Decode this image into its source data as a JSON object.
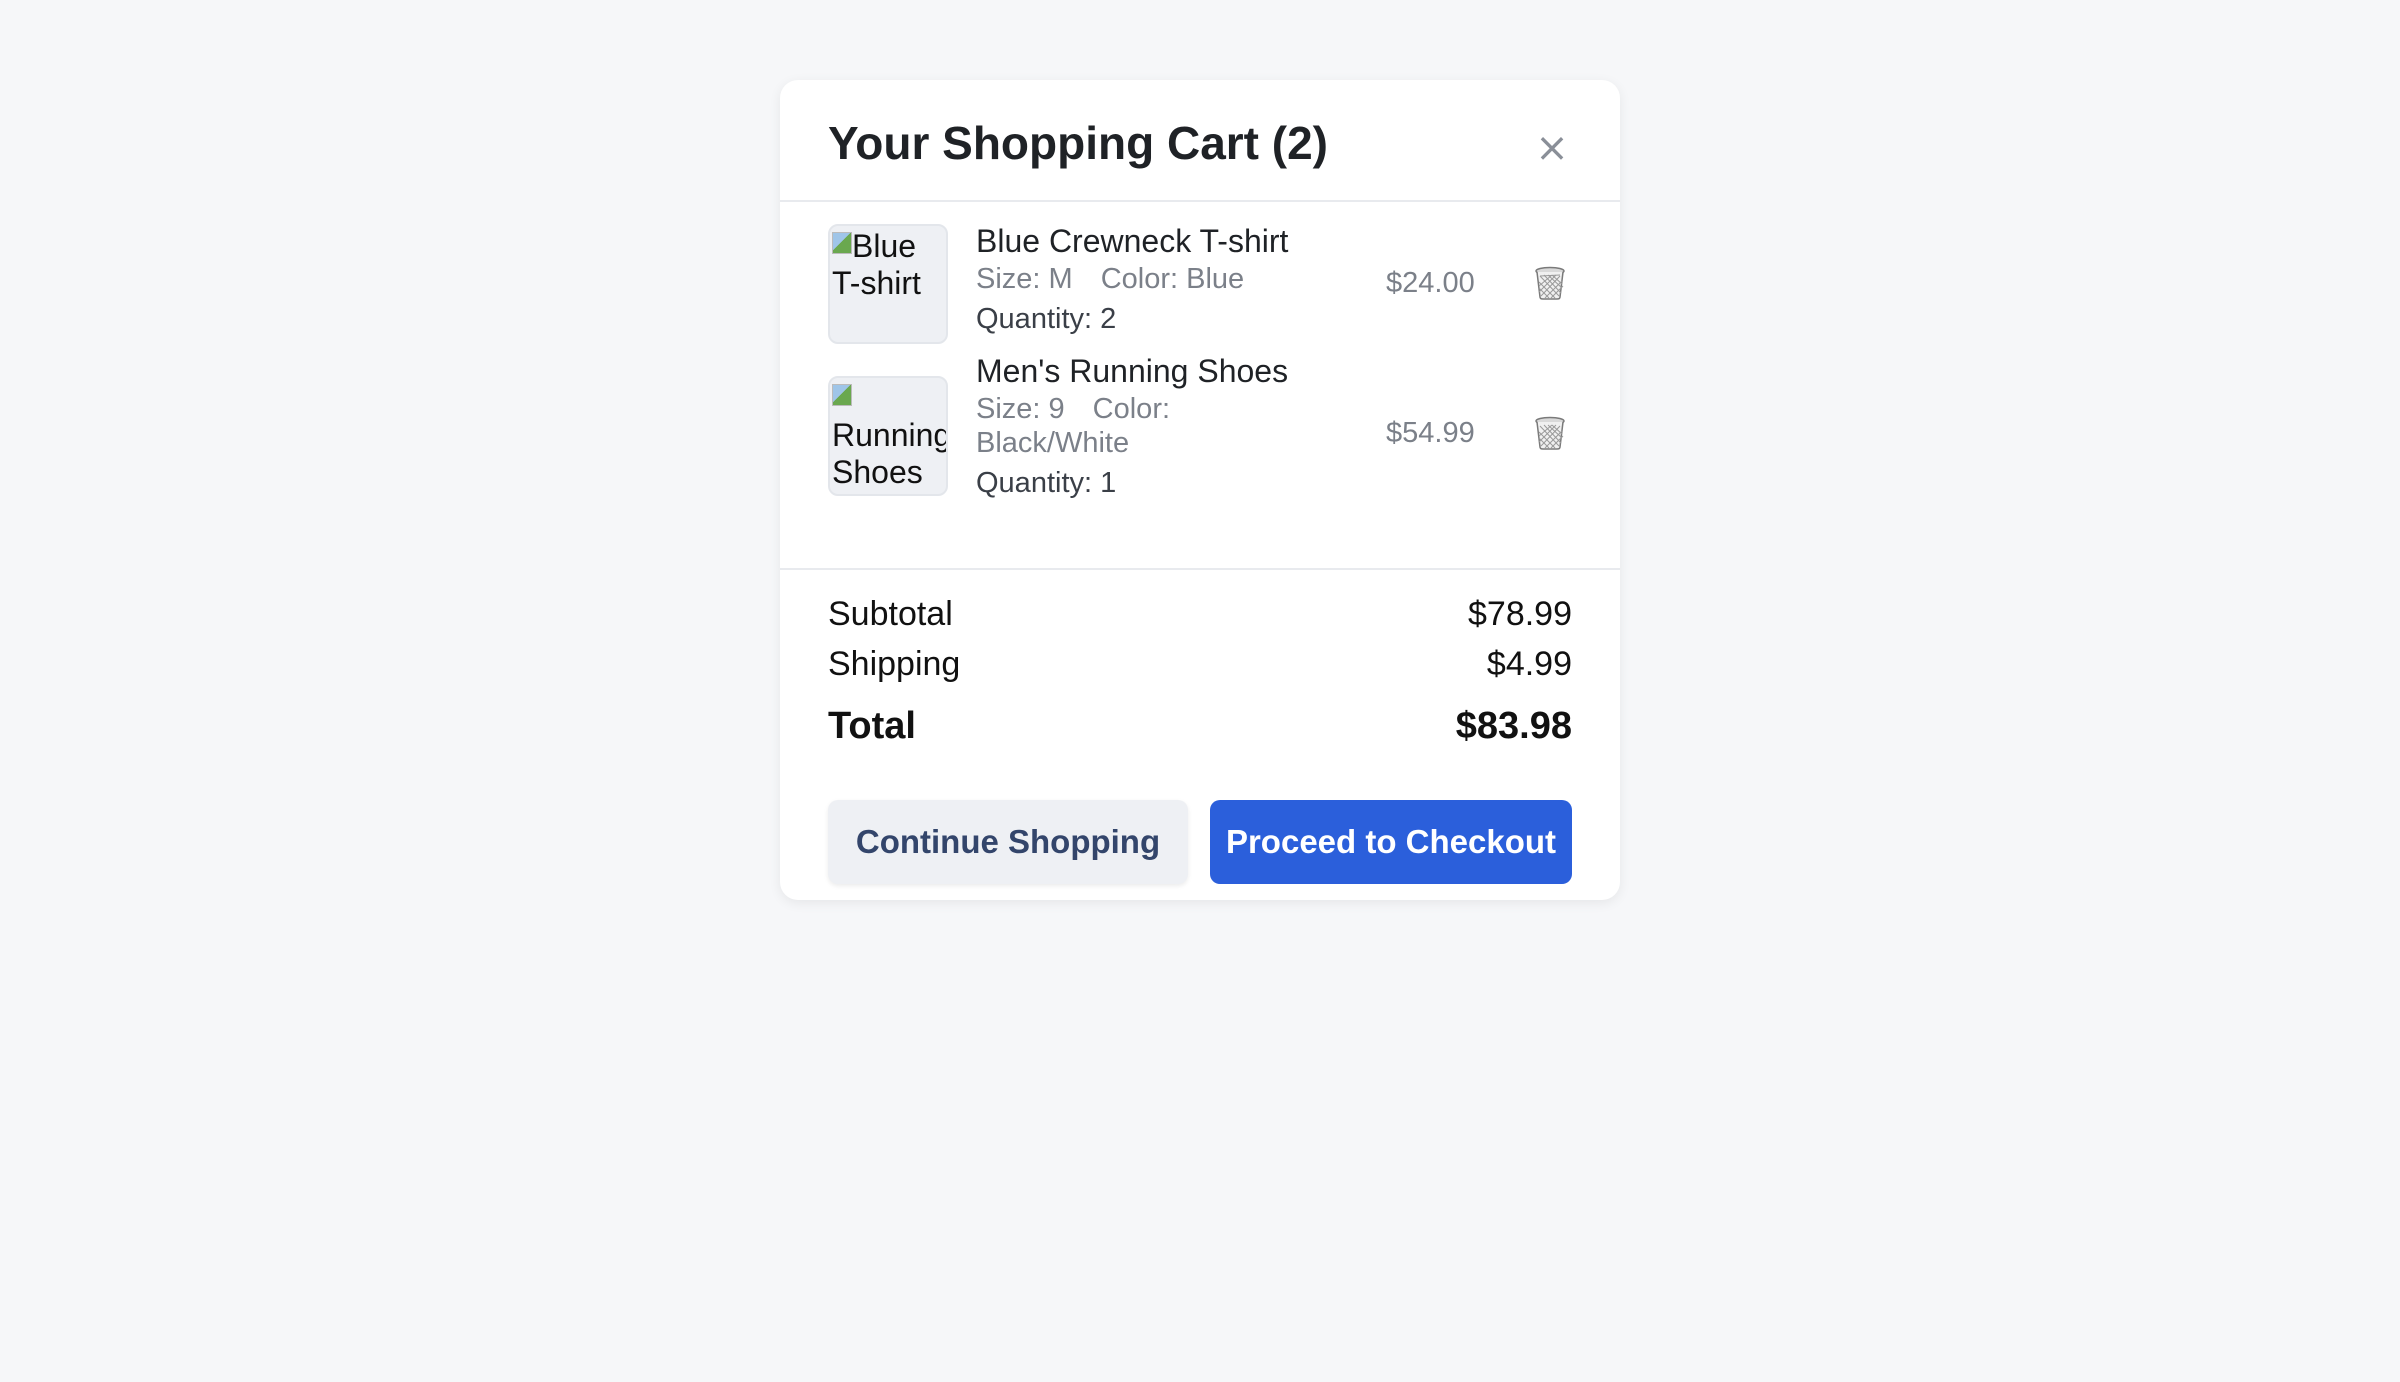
{
  "cart": {
    "title": "Your Shopping Cart (2)",
    "close_glyph": "×"
  },
  "items": [
    {
      "image_alt": "Blue T-shirt",
      "name": "Blue Crewneck T-shirt",
      "size": "Size: M",
      "color": "Color: Blue",
      "quantity": "Quantity: 2",
      "price": "$24.00",
      "remove_icon": "trash-icon"
    },
    {
      "image_alt": "Running Shoes",
      "name": "Men's Running Shoes",
      "size": "Size: 9",
      "color": "Color: Black/White",
      "quantity": "Quantity: 1",
      "price": "$54.99",
      "remove_icon": "trash-icon"
    }
  ],
  "summary": {
    "subtotal_label": "Subtotal",
    "subtotal_value": "$78.99",
    "shipping_label": "Shipping",
    "shipping_value": "$4.99",
    "total_label": "Total",
    "total_value": "$83.98"
  },
  "actions": {
    "continue_label": "Continue Shopping",
    "checkout_label": "Proceed to Checkout"
  },
  "colors": {
    "page_background": "#f6f7f9",
    "primary_button": "#2b5fdb",
    "secondary_button": "#eef0f4"
  }
}
